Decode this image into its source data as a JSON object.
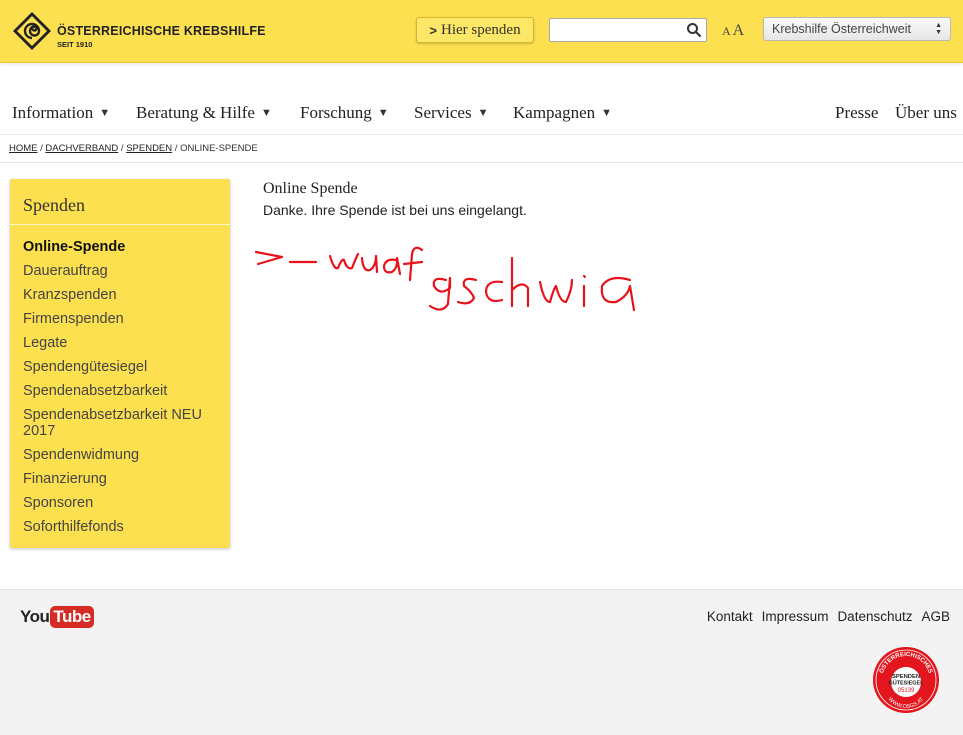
{
  "header": {
    "logo_name": "ÖSTERREICHISCHE KREBSHILFE",
    "logo_sub": "SEIT 1910",
    "donate_label": "Hier spenden",
    "search_placeholder": "",
    "font_small": "A",
    "font_big": "A",
    "region_selected": "Krebshilfe Österreichweit",
    "colors": {
      "brand_yellow": "#fde050",
      "text": "#222222"
    }
  },
  "nav": {
    "items": [
      {
        "label": "Information",
        "caret": "▼"
      },
      {
        "label": "Beratung & Hilfe",
        "caret": "▼"
      },
      {
        "label": "Forschung",
        "caret": "▼"
      },
      {
        "label": "Services",
        "caret": "▼"
      },
      {
        "label": "Kampagnen",
        "caret": "▼"
      }
    ],
    "right": [
      "Presse",
      "Über uns"
    ]
  },
  "breadcrumb": {
    "links": [
      "HOME",
      "DACHVERBAND",
      "SPENDEN"
    ],
    "separator": " / ",
    "current": "ONLINE-SPENDE"
  },
  "sidebar": {
    "title": "Spenden",
    "items": [
      "Online-Spende",
      "Dauerauftrag",
      "Kranzspenden",
      "Firmenspenden",
      "Legate",
      "Spendengütesiegel",
      "Spendenabsetzbarkeit",
      "Spendenabsetzbarkeit NEU 2017",
      "Spendenwidmung",
      "Finanzierung",
      "Sponsoren",
      "Soforthilfefonds"
    ],
    "active_index": 0
  },
  "main": {
    "title": "Online Spende",
    "text": "Danke. Ihre Spende ist bei uns eingelangt.",
    "annotation_color": "#e8121b"
  },
  "footer": {
    "youtube_you": "You",
    "youtube_tube": "Tube",
    "links": [
      "Kontakt",
      "Impressum",
      "Datenschutz",
      "AGB"
    ],
    "seal": {
      "top_text": "ÖSTERREICHISCHES",
      "line1": "SPENDEN",
      "line2": "GÜTESIEGEL",
      "number": "05139",
      "bottom_text": "WWW.OSGS.AT"
    }
  }
}
